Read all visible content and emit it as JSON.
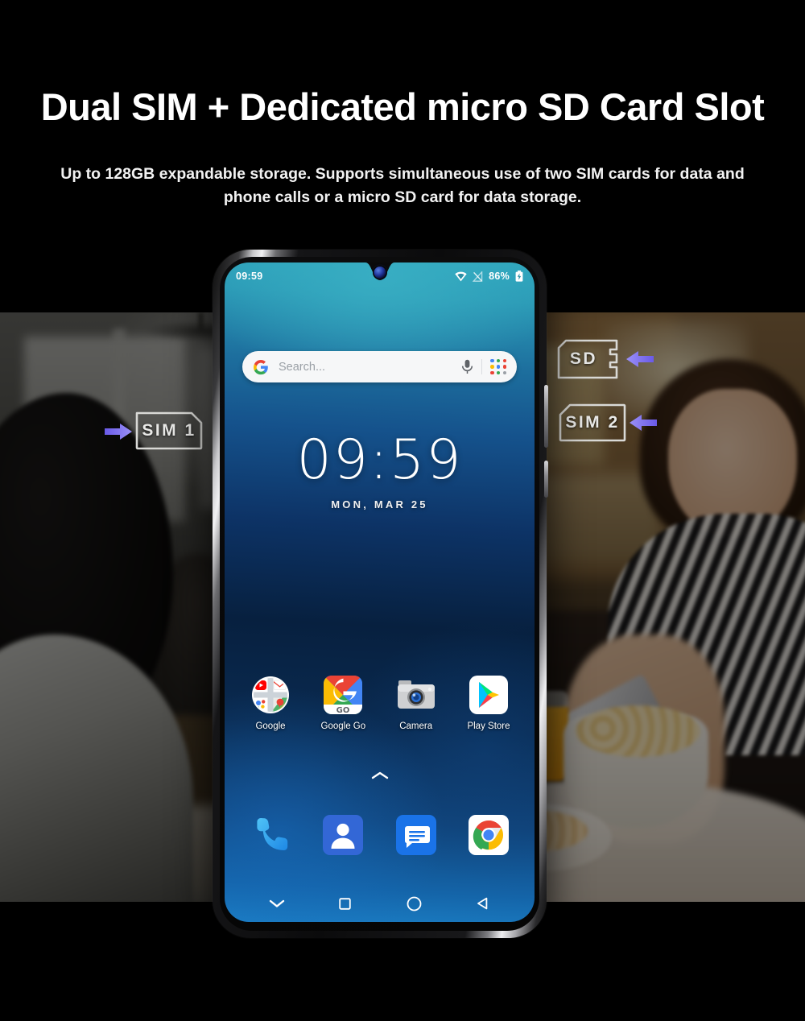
{
  "banner": {
    "headline": "Dual SIM + Dedicated micro SD Card Slot",
    "subline": "Up to 128GB expandable storage. Supports simultaneous use of two SIM cards for data and phone calls or a micro SD card for data storage.",
    "background": "#000000"
  },
  "callouts": [
    {
      "id": "sim1",
      "label": "SIM 1",
      "arrow_direction": "right",
      "arrow_color": "#7b6ff0",
      "side": "left"
    },
    {
      "id": "sd",
      "label": "SD",
      "arrow_direction": "left",
      "arrow_color": "#7b6ff0",
      "side": "right"
    },
    {
      "id": "sim2",
      "label": "SIM 2",
      "arrow_direction": "left",
      "arrow_color": "#7b6ff0",
      "side": "right"
    }
  ],
  "phone": {
    "status_bar": {
      "time": "09:59",
      "battery_percent": "86%",
      "icons": [
        "wifi-icon",
        "signal-off-icon",
        "battery-icon"
      ]
    },
    "search_widget": {
      "logo": "google-g-icon",
      "placeholder": "Search...",
      "mic_icon": "microphone-icon",
      "apps_icon": "google-apps-dots-icon"
    },
    "clock_widget": {
      "time": "09:59",
      "date": "MON, MAR 25"
    },
    "app_row": [
      {
        "label": "Google",
        "icon": "google-folder-icon"
      },
      {
        "label": "Google Go",
        "icon": "google-go-icon"
      },
      {
        "label": "Camera",
        "icon": "camera-icon"
      },
      {
        "label": "Play Store",
        "icon": "play-store-icon"
      }
    ],
    "app_drawer_handle": "chevron-up-icon",
    "dock": [
      {
        "label": "Phone",
        "icon": "phone-handset-icon"
      },
      {
        "label": "Contacts",
        "icon": "contacts-icon"
      },
      {
        "label": "Messages",
        "icon": "messages-icon"
      },
      {
        "label": "Chrome",
        "icon": "chrome-icon"
      }
    ],
    "nav_bar": [
      {
        "name": "hide-nav",
        "icon": "chevron-down-icon"
      },
      {
        "name": "recents",
        "icon": "square-icon"
      },
      {
        "name": "home",
        "icon": "circle-icon"
      },
      {
        "name": "back",
        "icon": "triangle-left-icon"
      }
    ]
  },
  "colors": {
    "accent_arrow": "#7b6ff0",
    "screen_top": "#2fa6bd",
    "screen_mid": "#07203f",
    "screen_bottom": "#1b7ec4",
    "card_outline": "#d9d9d6"
  }
}
